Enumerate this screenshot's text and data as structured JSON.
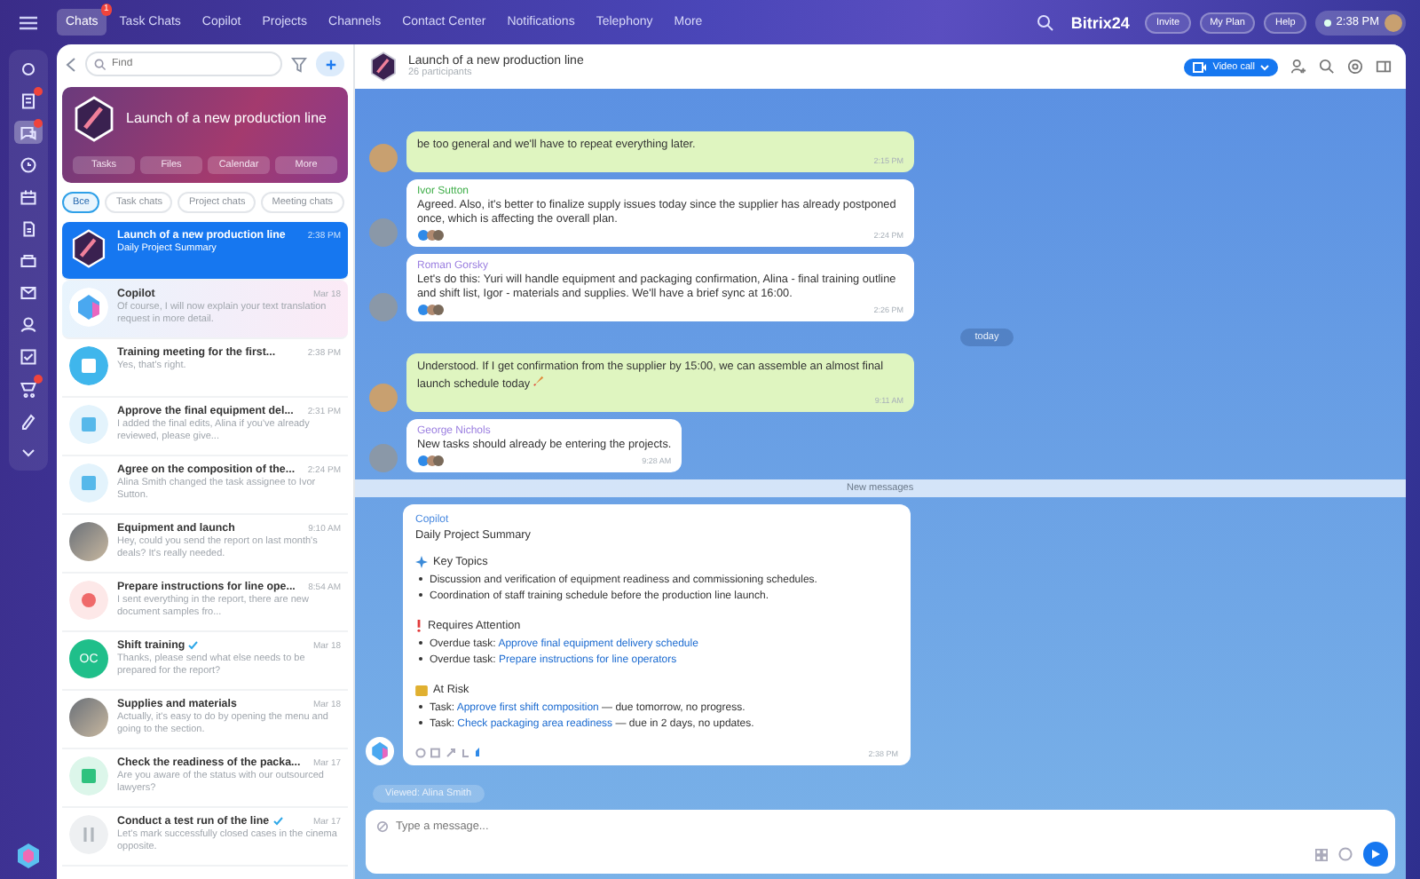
{
  "topbar": {
    "nav": [
      {
        "label": "Chats",
        "selected": true,
        "badge": "1"
      },
      {
        "label": "Task Chats",
        "selected": false
      },
      {
        "label": "Copilot",
        "selected": false
      },
      {
        "label": "Projects",
        "selected": false
      },
      {
        "label": "Channels",
        "selected": false
      },
      {
        "label": "Contact Center",
        "selected": false
      },
      {
        "label": "Notifications",
        "selected": false
      },
      {
        "label": "Telephony",
        "selected": false
      },
      {
        "label": "More",
        "selected": false
      }
    ],
    "brand": "Bitrix24",
    "buttons": [
      "Invite",
      "My Plan",
      "Help"
    ],
    "clock": "2:38 PM"
  },
  "rail": [
    {
      "selected": false,
      "badge": false
    },
    {
      "selected": false,
      "badge": true
    },
    {
      "selected": true,
      "badge": true
    },
    {
      "selected": false,
      "badge": false
    },
    {
      "selected": false,
      "badge": false
    },
    {
      "selected": false,
      "badge": false
    },
    {
      "selected": false,
      "badge": false
    },
    {
      "selected": false,
      "badge": false
    },
    {
      "selected": false,
      "badge": false
    },
    {
      "selected": false,
      "badge": false
    },
    {
      "selected": false,
      "badge": true
    },
    {
      "selected": false,
      "badge": false
    },
    {
      "selected": false,
      "badge": false
    }
  ],
  "chat_list": {
    "search": {
      "placeholder": "Find"
    },
    "group": {
      "title": "Launch of a new production line",
      "buttons": [
        "Tasks",
        "Files",
        "Calendar",
        "More"
      ]
    },
    "filters": [
      {
        "label": "Все",
        "selected": true
      },
      {
        "label": "Task chats",
        "selected": false
      },
      {
        "label": "Project chats",
        "selected": false
      },
      {
        "label": "Meeting chats",
        "selected": false
      }
    ],
    "chats": [
      {
        "kind": "group",
        "title": "Launch of a new production line",
        "time": "2:38 PM",
        "preview": "Daily Project Summary",
        "selected": true,
        "read": false
      },
      {
        "kind": "copilot",
        "title": "Copilot",
        "time": "Mar 18",
        "preview": "Of course, I will now explain your text translation request in more detail.",
        "selected": false,
        "read": false
      },
      {
        "kind": "meeting",
        "title": "Training meeting for the first...",
        "time": "2:38 PM",
        "preview": "Yes, that's right.",
        "selected": false,
        "read": false
      },
      {
        "kind": "task",
        "title": "Approve the final equipment del...",
        "time": "2:31 PM",
        "preview": "I added the final edits, Alina if you've already reviewed, please give...",
        "selected": false,
        "read": false
      },
      {
        "kind": "task",
        "title": "Agree on the composition of the...",
        "time": "2:24 PM",
        "preview": "Alina Smith changed the task assignee to Ivor Sutton.",
        "selected": false,
        "read": false
      },
      {
        "kind": "photo",
        "title": "Equipment and launch",
        "time": "9:10 AM",
        "preview": "Hey, could you send the report on last month's deals? It's really needed.",
        "selected": false,
        "read": false
      },
      {
        "kind": "alert",
        "title": "Prepare instructions for line ope...",
        "time": "8:54 AM",
        "preview": "I sent everything in the report, there are new document samples fro...",
        "selected": false,
        "read": false
      },
      {
        "kind": "initials",
        "initials": "OC",
        "title": "Shift training",
        "time": "Mar 18",
        "preview": "Thanks, please send what else needs to be prepared for the report?",
        "selected": false,
        "read": true
      },
      {
        "kind": "photo",
        "title": "Supplies and materials",
        "time": "Mar 18",
        "preview": "Actually, it's easy to do by opening the menu and going to the section.",
        "selected": false,
        "read": false
      },
      {
        "kind": "done",
        "title": "Check the readiness of the packa...",
        "time": "Mar 17",
        "preview": "Are you aware of the status with our outsourced lawyers?",
        "selected": false,
        "read": false
      },
      {
        "kind": "paused",
        "title": "Conduct a test run of the line",
        "time": "Mar 17",
        "preview": "Let's mark successfully closed cases in the cinema opposite.",
        "selected": false,
        "read": true
      }
    ]
  },
  "chat": {
    "title": "Launch of a new production line",
    "subtitle": "26 participants",
    "video_call": "Video call",
    "messages": [
      {
        "kind": "own",
        "text": "be too general and we'll have to repeat everything later.",
        "time": "2:15 PM"
      },
      {
        "kind": "other",
        "author": "Ivor Sutton",
        "color": "#3fae49",
        "text": "Agreed. Also, it's better to finalize supply issues today since the supplier has already postponed once, which is affecting the overall plan.",
        "time": "2:24 PM"
      },
      {
        "kind": "other",
        "author": "Roman Gorsky",
        "color": "#9b7fe0",
        "text": "Let's do this: Yuri will handle equipment and packaging confirmation, Alina - final training outline and shift list, Igor - materials and supplies. We'll have a brief sync at 16:00.",
        "time": "2:26 PM"
      },
      {
        "kind": "date",
        "text": "today"
      },
      {
        "kind": "own",
        "text": "Understood. If I get confirmation from the supplier by 15:00, we can assemble an almost final launch schedule today",
        "time": "9:11 AM",
        "rocket": true
      },
      {
        "kind": "other",
        "author": "George Nichols",
        "color": "#9b7fe0",
        "text": "New tasks should already be entering the projects.",
        "time": "9:28 AM"
      },
      {
        "kind": "divider",
        "text": "New messages"
      }
    ],
    "copilot": {
      "author": "Copilot",
      "title": "Daily Project Summary",
      "time": "2:38 PM",
      "sections": [
        {
          "kind": "topics",
          "heading": "Key Topics",
          "items": [
            {
              "text": "Discussion and verification of equipment readiness and commissioning schedules."
            },
            {
              "text": "Coordination of staff training schedule before the production line launch."
            }
          ]
        },
        {
          "kind": "attention",
          "heading": "Requires Attention",
          "items": [
            {
              "text": "Overdue task: ",
              "link": "Approve final equipment delivery schedule"
            },
            {
              "text": "Overdue task: ",
              "link": "Prepare instructions for line operators"
            }
          ]
        },
        {
          "kind": "risk",
          "heading": "At Risk",
          "items": [
            {
              "text": "Task: ",
              "link": "Approve first shift composition",
              "after": " — due tomorrow, no progress."
            },
            {
              "text": "Task: ",
              "link": "Check packaging area readiness",
              "after": " — due in 2 days, no updates."
            }
          ]
        }
      ]
    },
    "viewed": "Viewed: Alina Smith",
    "input": {
      "placeholder": "Type a message..."
    }
  }
}
